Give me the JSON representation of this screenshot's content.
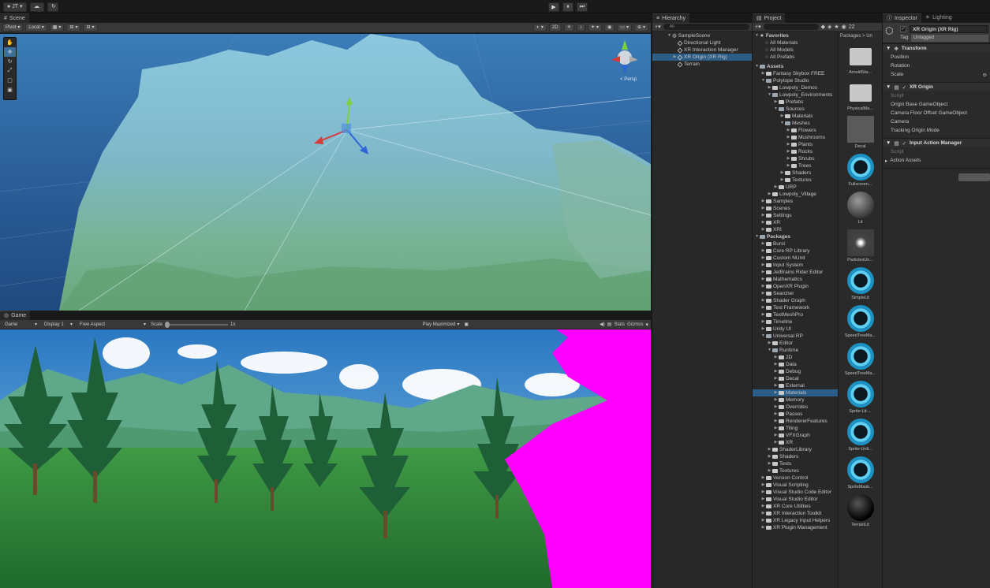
{
  "topbar": {
    "account": "JT",
    "play_buttons": [
      "▶",
      "⏸",
      "⏭"
    ]
  },
  "scene": {
    "tab": "Scene",
    "pivot": "Pivot",
    "local": "Local",
    "mode2d": "2D",
    "persp": "< Persp"
  },
  "game": {
    "tab": "Game",
    "mode": "Game",
    "display": "Display 1",
    "aspect": "Free Aspect",
    "scale_label": "Scale",
    "scale_value": "1x",
    "play_maximized": "Play Maximized",
    "stats": "Stats",
    "gizmos": "Gizmos"
  },
  "hierarchy": {
    "tab": "Hierarchy",
    "search": "All",
    "items": [
      "SampleScene",
      "Directional Light",
      "XR Interaction Manager",
      "XR Origin (XR Rig)",
      "Terrain"
    ]
  },
  "project": {
    "tab": "Project",
    "breadcrumb": "Packages > Un",
    "count": "22",
    "favorites": {
      "label": "Favorites",
      "items": [
        "All Materials",
        "All Models",
        "All Prefabs"
      ]
    },
    "tree": [
      {
        "t": "Assets",
        "d": 0,
        "o": true,
        "b": true
      },
      {
        "t": "Fantasy Skybox FREE",
        "d": 1
      },
      {
        "t": "Polytope Studio",
        "d": 1,
        "o": true
      },
      {
        "t": "Lowpoly_Demos",
        "d": 2
      },
      {
        "t": "Lowpoly_Environments",
        "d": 2,
        "o": true
      },
      {
        "t": "Prefabs",
        "d": 3
      },
      {
        "t": "Sources",
        "d": 3,
        "o": true
      },
      {
        "t": "Materials",
        "d": 4
      },
      {
        "t": "Meshes",
        "d": 4,
        "o": true
      },
      {
        "t": "Flowers",
        "d": 5
      },
      {
        "t": "Mushrooms",
        "d": 5
      },
      {
        "t": "Plants",
        "d": 5
      },
      {
        "t": "Rocks",
        "d": 5
      },
      {
        "t": "Shrubs",
        "d": 5
      },
      {
        "t": "Trees",
        "d": 5
      },
      {
        "t": "Shaders",
        "d": 4
      },
      {
        "t": "Textures",
        "d": 4
      },
      {
        "t": "URP",
        "d": 3
      },
      {
        "t": "Lowpoly_Village",
        "d": 2
      },
      {
        "t": "Samples",
        "d": 1
      },
      {
        "t": "Scenes",
        "d": 1
      },
      {
        "t": "Settings",
        "d": 1
      },
      {
        "t": "XR",
        "d": 1
      },
      {
        "t": "XRI",
        "d": 1
      },
      {
        "t": "Packages",
        "d": 0,
        "o": true,
        "b": true
      },
      {
        "t": "Burst",
        "d": 1
      },
      {
        "t": "Core RP Library",
        "d": 1
      },
      {
        "t": "Custom NUnit",
        "d": 1
      },
      {
        "t": "Input System",
        "d": 1
      },
      {
        "t": "JetBrains Rider Editor",
        "d": 1
      },
      {
        "t": "Mathematics",
        "d": 1
      },
      {
        "t": "OpenXR Plugin",
        "d": 1
      },
      {
        "t": "Searcher",
        "d": 1
      },
      {
        "t": "Shader Graph",
        "d": 1
      },
      {
        "t": "Test Framework",
        "d": 1
      },
      {
        "t": "TextMeshPro",
        "d": 1
      },
      {
        "t": "Timeline",
        "d": 1
      },
      {
        "t": "Unity UI",
        "d": 1
      },
      {
        "t": "Universal RP",
        "d": 1,
        "o": true
      },
      {
        "t": "Editor",
        "d": 2
      },
      {
        "t": "Runtime",
        "d": 2,
        "o": true
      },
      {
        "t": "2D",
        "d": 3
      },
      {
        "t": "Data",
        "d": 3
      },
      {
        "t": "Debug",
        "d": 3
      },
      {
        "t": "Decal",
        "d": 3
      },
      {
        "t": "External",
        "d": 3
      },
      {
        "t": "Materials",
        "d": 3,
        "s": true
      },
      {
        "t": "Memory",
        "d": 3
      },
      {
        "t": "Overrides",
        "d": 3
      },
      {
        "t": "Passes",
        "d": 3
      },
      {
        "t": "RendererFeatures",
        "d": 3
      },
      {
        "t": "Tiling",
        "d": 3
      },
      {
        "t": "VFXGraph",
        "d": 3
      },
      {
        "t": "XR",
        "d": 3
      },
      {
        "t": "ShaderLibrary",
        "d": 2
      },
      {
        "t": "Shaders",
        "d": 2
      },
      {
        "t": "Tests",
        "d": 2
      },
      {
        "t": "Textures",
        "d": 2
      },
      {
        "t": "Version Control",
        "d": 1
      },
      {
        "t": "Visual Scripting",
        "d": 1
      },
      {
        "t": "Visual Studio Code Editor",
        "d": 1
      },
      {
        "t": "Visual Studio Editor",
        "d": 1
      },
      {
        "t": "XR Core Utilities",
        "d": 1
      },
      {
        "t": "XR Interaction Toolkit",
        "d": 1
      },
      {
        "t": "XR Legacy Input Helpers",
        "d": 1
      },
      {
        "t": "XR Plugin Management",
        "d": 1
      }
    ],
    "assets": [
      {
        "name": "ArnoldSta...",
        "kind": "folder"
      },
      {
        "name": "PhysicalMa...",
        "kind": "folder"
      },
      {
        "name": "Decal",
        "kind": "gray"
      },
      {
        "name": "Fullscreen...",
        "kind": "ring"
      },
      {
        "name": "Lit",
        "kind": "lit"
      },
      {
        "name": "ParticlesUn...",
        "kind": "particle"
      },
      {
        "name": "SimpleLit",
        "kind": "ring"
      },
      {
        "name": "SpeedTreeMa...",
        "kind": "ring"
      },
      {
        "name": "SpeedTreeMa...",
        "kind": "ring"
      },
      {
        "name": "Sprite-Lit-...",
        "kind": "ring"
      },
      {
        "name": "Sprite-Unli...",
        "kind": "ring"
      },
      {
        "name": "SpriteMask...",
        "kind": "ring"
      },
      {
        "name": "TerrainLit",
        "kind": "black"
      }
    ]
  },
  "inspector": {
    "tab": "Inspector",
    "tab2": "Lighting",
    "object_name": "XR Origin (XR Rig)",
    "tag_label": "Tag",
    "tag_value": "Untagged",
    "transform": {
      "title": "Transform",
      "fields": [
        "Position",
        "Rotation",
        "Scale"
      ]
    },
    "xr_origin": {
      "title": "XR Origin",
      "fields": [
        "Script",
        "Origin Base GameObject",
        "Camera Floor Offset GameObject",
        "Camera",
        "Tracking Origin Mode"
      ]
    },
    "input_action": {
      "title": "Input Action Manager",
      "fields": [
        "Script",
        "Action Assets"
      ]
    }
  }
}
